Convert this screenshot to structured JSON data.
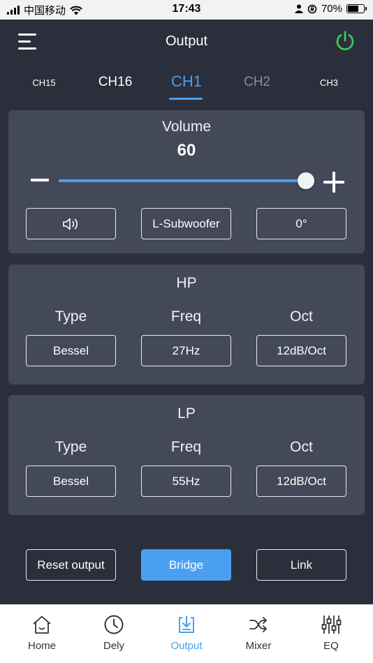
{
  "status_bar": {
    "carrier": "中国移动",
    "time": "17:43",
    "battery": "70%"
  },
  "header": {
    "title": "Output"
  },
  "tabs": [
    {
      "label": "CH15"
    },
    {
      "label": "CH16"
    },
    {
      "label": "CH1"
    },
    {
      "label": "CH2"
    },
    {
      "label": "CH3"
    }
  ],
  "active_tab": "CH1",
  "volume": {
    "title": "Volume",
    "value": "60",
    "level_fraction": 1.0,
    "subwoofer_label": "L-Subwoofer",
    "phase_label": "0°",
    "speaker_icon": "speaker-icon"
  },
  "hp": {
    "title": "HP",
    "type_label": "Type",
    "freq_label": "Freq",
    "oct_label": "Oct",
    "type_value": "Bessel",
    "freq_value": "27Hz",
    "oct_value": "12dB/Oct"
  },
  "lp": {
    "title": "LP",
    "type_label": "Type",
    "freq_label": "Freq",
    "oct_label": "Oct",
    "type_value": "Bessel",
    "freq_value": "55Hz",
    "oct_value": "12dB/Oct"
  },
  "actions": {
    "reset": "Reset output",
    "bridge": "Bridge",
    "link": "Link"
  },
  "nav": [
    {
      "label": "Home",
      "icon": "home-icon"
    },
    {
      "label": "Dely",
      "icon": "clock-icon"
    },
    {
      "label": "Output",
      "icon": "output-icon"
    },
    {
      "label": "Mixer",
      "icon": "shuffle-icon"
    },
    {
      "label": "EQ",
      "icon": "equalizer-icon"
    }
  ],
  "active_nav": "Output",
  "colors": {
    "accent": "#4a9ff0",
    "power": "#3fd05a",
    "background": "#2b2f3b",
    "panel": "#434959"
  }
}
